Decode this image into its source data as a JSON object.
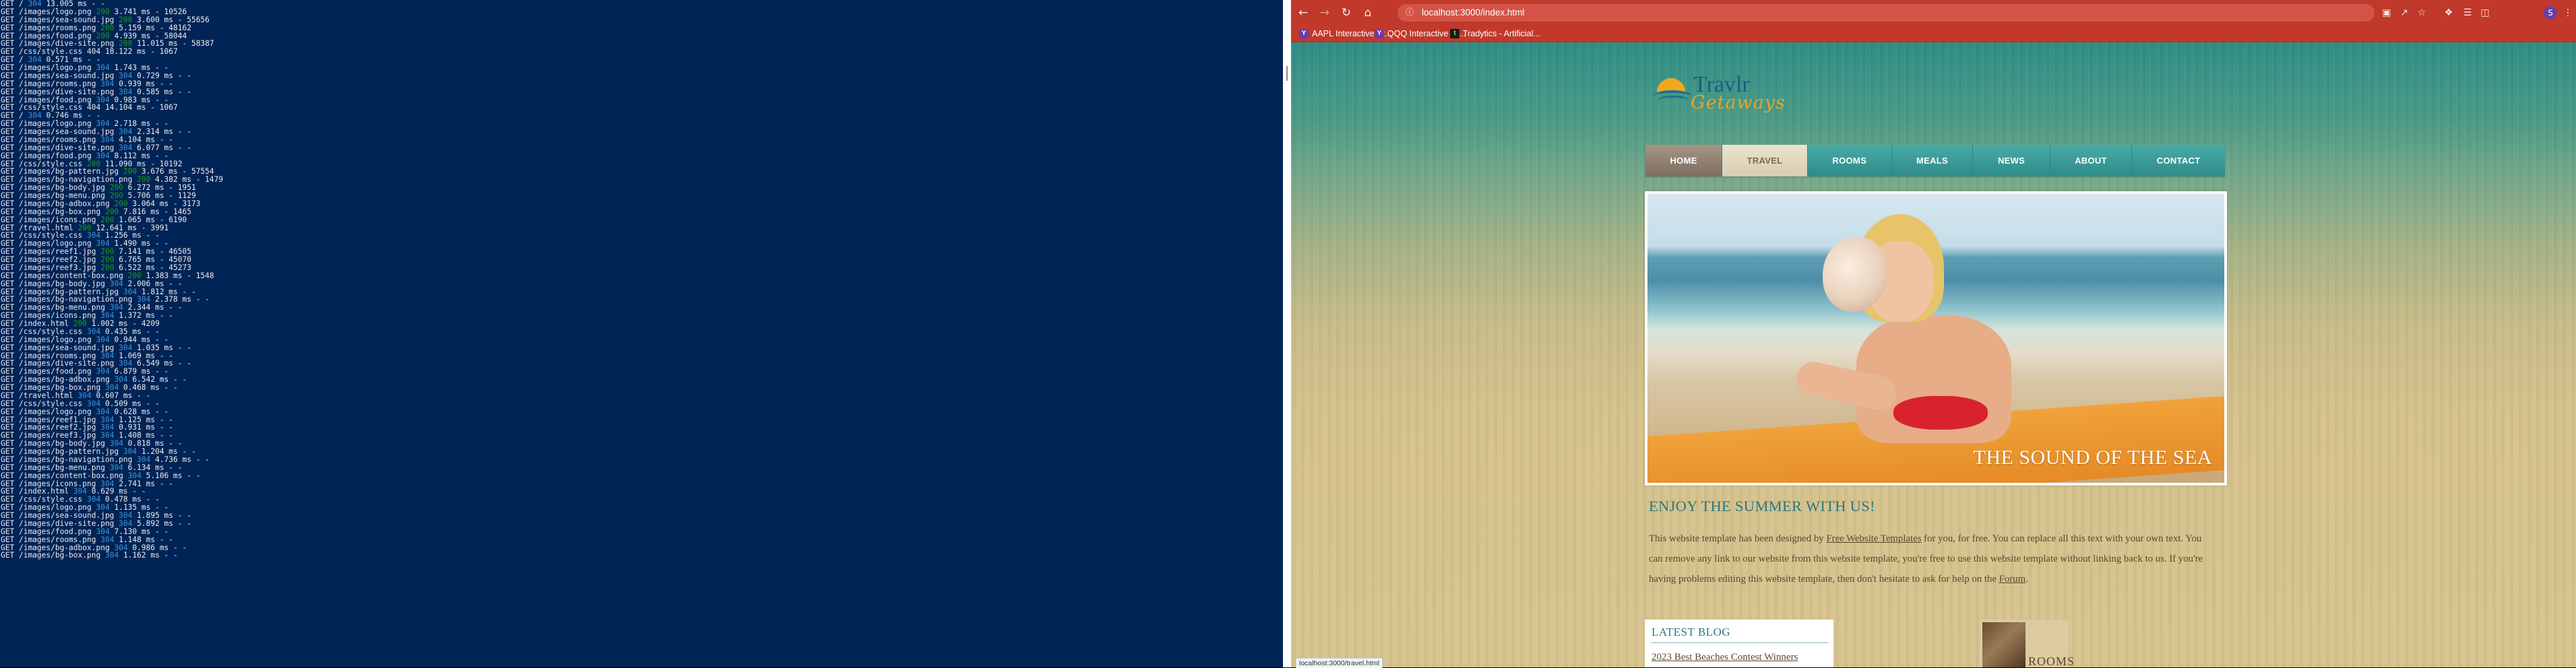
{
  "terminal": {
    "lines": [
      {
        "m": "GET",
        "p": "/",
        "s": "304",
        "r": "13.005 ms - -"
      },
      {
        "m": "GET",
        "p": "/images/logo.png",
        "s": "200",
        "r": "3.741 ms - 10526"
      },
      {
        "m": "GET",
        "p": "/images/sea-sound.jpg",
        "s": "200",
        "r": "3.600 ms - 55656"
      },
      {
        "m": "GET",
        "p": "/images/rooms.png",
        "s": "200",
        "r": "5.159 ms - 48162"
      },
      {
        "m": "GET",
        "p": "/images/food.png",
        "s": "200",
        "r": "4.939 ms - 58044"
      },
      {
        "m": "GET",
        "p": "/images/dive-site.png",
        "s": "200",
        "r": "11.015 ms - 58387"
      },
      {
        "m": "GET",
        "p": "/css/style.css",
        "s": "404",
        "r": "18.122 ms - 1067"
      },
      {
        "m": "GET",
        "p": "/",
        "s": "304",
        "r": "0.571 ms - -"
      },
      {
        "m": "GET",
        "p": "/images/logo.png",
        "s": "304",
        "r": "1.743 ms - -"
      },
      {
        "m": "GET",
        "p": "/images/sea-sound.jpg",
        "s": "304",
        "r": "0.729 ms - -"
      },
      {
        "m": "GET",
        "p": "/images/rooms.png",
        "s": "304",
        "r": "0.939 ms - -"
      },
      {
        "m": "GET",
        "p": "/images/dive-site.png",
        "s": "304",
        "r": "0.585 ms - -"
      },
      {
        "m": "GET",
        "p": "/images/food.png",
        "s": "304",
        "r": "0.983 ms - -"
      },
      {
        "m": "GET",
        "p": "/css/style.css",
        "s": "404",
        "r": "14.104 ms - 1067"
      },
      {
        "m": "GET",
        "p": "/",
        "s": "304",
        "r": "0.746 ms - -"
      },
      {
        "m": "GET",
        "p": "/images/logo.png",
        "s": "304",
        "r": "2.718 ms - -"
      },
      {
        "m": "GET",
        "p": "/images/sea-sound.jpg",
        "s": "304",
        "r": "2.314 ms - -"
      },
      {
        "m": "GET",
        "p": "/images/rooms.png",
        "s": "304",
        "r": "4.104 ms - -"
      },
      {
        "m": "GET",
        "p": "/images/dive-site.png",
        "s": "304",
        "r": "6.077 ms - -"
      },
      {
        "m": "GET",
        "p": "/images/food.png",
        "s": "304",
        "r": "8.112 ms - -"
      },
      {
        "m": "GET",
        "p": "/css/style.css",
        "s": "200",
        "r": "11.090 ms - 10192"
      },
      {
        "m": "GET",
        "p": "/images/bg-pattern.jpg",
        "s": "200",
        "r": "3.676 ms - 57554"
      },
      {
        "m": "GET",
        "p": "/images/bg-navigation.png",
        "s": "200",
        "r": "4.382 ms - 1479"
      },
      {
        "m": "GET",
        "p": "/images/bg-body.jpg",
        "s": "200",
        "r": "6.272 ms - 1951"
      },
      {
        "m": "GET",
        "p": "/images/bg-menu.png",
        "s": "200",
        "r": "5.706 ms - 1129"
      },
      {
        "m": "GET",
        "p": "/images/bg-adbox.png",
        "s": "200",
        "r": "3.064 ms - 3173"
      },
      {
        "m": "GET",
        "p": "/images/bg-box.png",
        "s": "200",
        "r": "7.816 ms - 1465"
      },
      {
        "m": "GET",
        "p": "/images/icons.png",
        "s": "200",
        "r": "1.065 ms - 6190"
      },
      {
        "m": "GET",
        "p": "/travel.html",
        "s": "200",
        "r": "12.641 ms - 3991"
      },
      {
        "m": "GET",
        "p": "/css/style.css",
        "s": "304",
        "r": "1.256 ms - -"
      },
      {
        "m": "GET",
        "p": "/images/logo.png",
        "s": "304",
        "r": "1.490 ms - -"
      },
      {
        "m": "GET",
        "p": "/images/reef1.jpg",
        "s": "200",
        "r": "7.141 ms - 46505"
      },
      {
        "m": "GET",
        "p": "/images/reef2.jpg",
        "s": "200",
        "r": "6.765 ms - 45070"
      },
      {
        "m": "GET",
        "p": "/images/reef3.jpg",
        "s": "200",
        "r": "6.522 ms - 45273"
      },
      {
        "m": "GET",
        "p": "/images/content-box.png",
        "s": "200",
        "r": "1.383 ms - 1548"
      },
      {
        "m": "GET",
        "p": "/images/bg-body.jpg",
        "s": "304",
        "r": "2.006 ms - -"
      },
      {
        "m": "GET",
        "p": "/images/bg-pattern.jpg",
        "s": "304",
        "r": "1.812 ms - -"
      },
      {
        "m": "GET",
        "p": "/images/bg-navigation.png",
        "s": "304",
        "r": "2.378 ms - -"
      },
      {
        "m": "GET",
        "p": "/images/bg-menu.png",
        "s": "304",
        "r": "2.344 ms - -"
      },
      {
        "m": "GET",
        "p": "/images/icons.png",
        "s": "304",
        "r": "1.372 ms - -"
      },
      {
        "m": "GET",
        "p": "/index.html",
        "s": "200",
        "r": "1.002 ms - 4209"
      },
      {
        "m": "GET",
        "p": "/css/style.css",
        "s": "304",
        "r": "0.435 ms - -"
      },
      {
        "m": "GET",
        "p": "/images/logo.png",
        "s": "304",
        "r": "0.944 ms - -"
      },
      {
        "m": "GET",
        "p": "/images/sea-sound.jpg",
        "s": "304",
        "r": "1.035 ms - -"
      },
      {
        "m": "GET",
        "p": "/images/rooms.png",
        "s": "304",
        "r": "1.069 ms - -"
      },
      {
        "m": "GET",
        "p": "/images/dive-site.png",
        "s": "304",
        "r": "6.549 ms - -"
      },
      {
        "m": "GET",
        "p": "/images/food.png",
        "s": "304",
        "r": "6.879 ms - -"
      },
      {
        "m": "GET",
        "p": "/images/bg-adbox.png",
        "s": "304",
        "r": "6.542 ms - -"
      },
      {
        "m": "GET",
        "p": "/images/bg-box.png",
        "s": "304",
        "r": "0.468 ms - -"
      },
      {
        "m": "GET",
        "p": "/travel.html",
        "s": "304",
        "r": "0.607 ms - -"
      },
      {
        "m": "GET",
        "p": "/css/style.css",
        "s": "304",
        "r": "0.509 ms - -"
      },
      {
        "m": "GET",
        "p": "/images/logo.png",
        "s": "304",
        "r": "0.628 ms - -"
      },
      {
        "m": "GET",
        "p": "/images/reef1.jpg",
        "s": "304",
        "r": "1.125 ms - -"
      },
      {
        "m": "GET",
        "p": "/images/reef2.jpg",
        "s": "304",
        "r": "0.931 ms - -"
      },
      {
        "m": "GET",
        "p": "/images/reef3.jpg",
        "s": "304",
        "r": "1.408 ms - -"
      },
      {
        "m": "GET",
        "p": "/images/bg-body.jpg",
        "s": "304",
        "r": "0.818 ms - -"
      },
      {
        "m": "GET",
        "p": "/images/bg-pattern.jpg",
        "s": "304",
        "r": "1.204 ms - -"
      },
      {
        "m": "GET",
        "p": "/images/bg-navigation.png",
        "s": "304",
        "r": "4.736 ms - -"
      },
      {
        "m": "GET",
        "p": "/images/bg-menu.png",
        "s": "304",
        "r": "6.134 ms - -"
      },
      {
        "m": "GET",
        "p": "/images/content-box.png",
        "s": "304",
        "r": "5.106 ms - -"
      },
      {
        "m": "GET",
        "p": "/images/icons.png",
        "s": "304",
        "r": "2.741 ms - -"
      },
      {
        "m": "GET",
        "p": "/index.html",
        "s": "304",
        "r": "0.629 ms - -"
      },
      {
        "m": "GET",
        "p": "/css/style.css",
        "s": "304",
        "r": "0.478 ms - -"
      },
      {
        "m": "GET",
        "p": "/images/logo.png",
        "s": "304",
        "r": "1.135 ms - -"
      },
      {
        "m": "GET",
        "p": "/images/sea-sound.jpg",
        "s": "304",
        "r": "1.895 ms - -"
      },
      {
        "m": "GET",
        "p": "/images/dive-site.png",
        "s": "304",
        "r": "5.892 ms - -"
      },
      {
        "m": "GET",
        "p": "/images/food.png",
        "s": "304",
        "r": "7.130 ms - -"
      },
      {
        "m": "GET",
        "p": "/images/rooms.png",
        "s": "304",
        "r": "1.148 ms - -"
      },
      {
        "m": "GET",
        "p": "/images/bg-adbox.png",
        "s": "304",
        "r": "0.986 ms - -"
      },
      {
        "m": "GET",
        "p": "/images/bg-box.png",
        "s": "304",
        "r": "1.162 ms - -"
      }
    ]
  },
  "colors": {
    "terminal_bg": "#012456",
    "status_200": "#13a10e",
    "status_304": "#3a96dd",
    "browser_toolbar": "#c0392b",
    "nav_teal": "#3a9a98",
    "heading_teal": "#2b7780"
  },
  "browser": {
    "url": "localhost:3000/index.html",
    "profile_initial": "S",
    "bookmarks": [
      {
        "label": "AAPL Interactive St...",
        "icon": "yahoo-icon"
      },
      {
        "label": "QQQ Interactive St...",
        "icon": "yahoo-icon"
      },
      {
        "label": "Tradytics - Artificial...",
        "icon": "tradytics-icon"
      }
    ],
    "status_url": "localhost:3000/travel.html"
  },
  "site": {
    "logo_name": "Travlr",
    "logo_sub": "Getaways",
    "nav": [
      "HOME",
      "TRAVEL",
      "ROOMS",
      "MEALS",
      "NEWS",
      "ABOUT",
      "CONTACT"
    ],
    "hero_caption": "THE SOUND OF THE SEA",
    "heading": "ENJOY THE SUMMER WITH US!",
    "intro_before": "This website template has been designed by ",
    "intro_link1": "Free Website Templates",
    "intro_mid": " for you, for free. You can replace all this text with your own text. You can remove any link to our website from this website template, you're free to use this website template without linking back to us. If you're having problems editing this website template, then don't hesitate to ask for help on the ",
    "intro_link2": "Forum",
    "intro_end": ".",
    "blog_title": "LATEST BLOG",
    "blog_post": "2023 Best Beaches Contest Winners",
    "rooms_label": "ROOMS"
  }
}
